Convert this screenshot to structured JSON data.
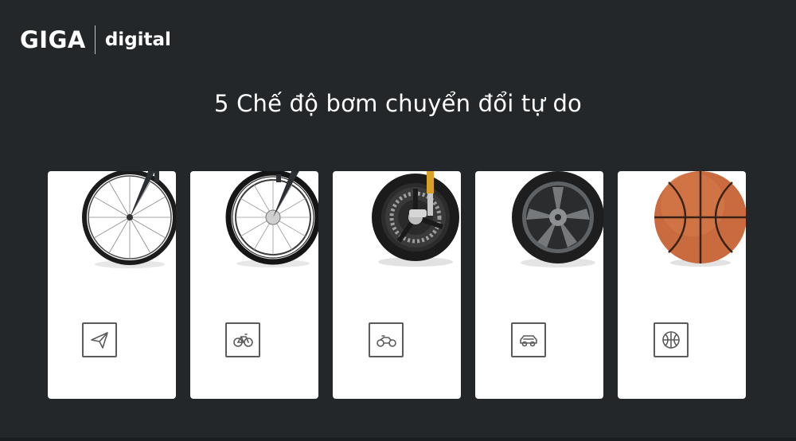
{
  "brand": {
    "name": "GIGA",
    "subtitle": "digital"
  },
  "headline": "5 Chế độ bơm chuyển đổi tự do",
  "modes": [
    {
      "visual": "road-bike-wheel",
      "icon": "paper-plane-icon"
    },
    {
      "visual": "folding-bike-wheel",
      "icon": "bicycle-icon"
    },
    {
      "visual": "motorcycle-wheel",
      "icon": "motorcycle-icon"
    },
    {
      "visual": "car-wheel",
      "icon": "car-icon"
    },
    {
      "visual": "basketball",
      "icon": "basketball-icon"
    }
  ],
  "colors": {
    "background": "#23272a",
    "card": "#ffffff",
    "icon_stroke": "#5b5b5b",
    "basketball": "#c96a3f"
  }
}
